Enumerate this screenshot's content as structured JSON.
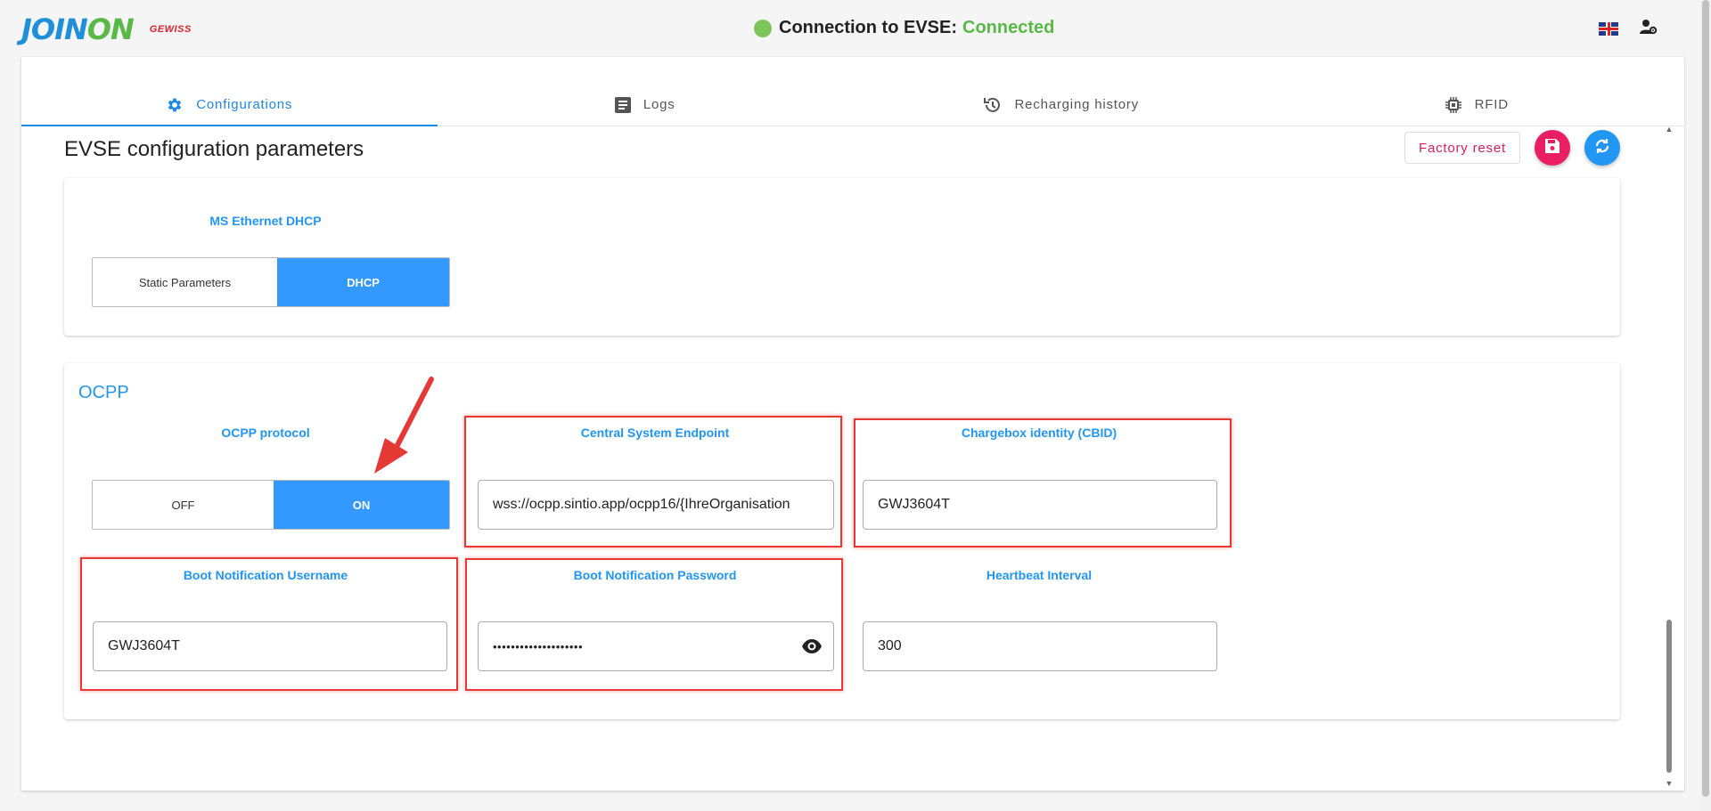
{
  "header": {
    "logo_main_a": "JOIN",
    "logo_main_b": "ON",
    "logo_sub": "GEWISS",
    "connection_label": "Connection to EVSE:",
    "connection_status": "Connected",
    "status_color": "#58b947",
    "language_icon": "uk-flag-icon",
    "user_settings_icon": "user-gear-icon"
  },
  "tabs": [
    {
      "label": "Configurations",
      "icon": "gear-icon",
      "active": true
    },
    {
      "label": "Logs",
      "icon": "document-icon",
      "active": false
    },
    {
      "label": "Recharging history",
      "icon": "history-icon",
      "active": false
    },
    {
      "label": "RFID",
      "icon": "chip-icon",
      "active": false
    }
  ],
  "page": {
    "title": "EVSE configuration parameters",
    "factory_reset_label": "Factory reset",
    "save_icon": "save-icon",
    "sync_icon": "sync-icon"
  },
  "ethernet": {
    "label": "MS Ethernet DHCP",
    "options": [
      "Static Parameters",
      "DHCP"
    ],
    "selected": "DHCP"
  },
  "ocpp": {
    "section_title": "OCPP",
    "protocol_label": "OCPP protocol",
    "protocol_options": [
      "OFF",
      "ON"
    ],
    "protocol_selected": "ON",
    "endpoint_label": "Central System Endpoint",
    "endpoint_value": "wss://ocpp.sintio.app/ocpp16/{IhreOrganisation",
    "cbid_label": "Chargebox identity (CBID)",
    "cbid_value": "GWJ3604T",
    "username_label": "Boot Notification Username",
    "username_value": "GWJ3604T",
    "password_label": "Boot Notification Password",
    "password_value": "••••••••••••••••••••",
    "heartbeat_label": "Heartbeat Interval",
    "heartbeat_value": "300"
  },
  "colors": {
    "accent": "#2196f3",
    "selected_toggle": "#3399ff",
    "highlight": "#e53935",
    "save_fab": "#e91e63",
    "factory_reset_text": "#d81b60"
  }
}
